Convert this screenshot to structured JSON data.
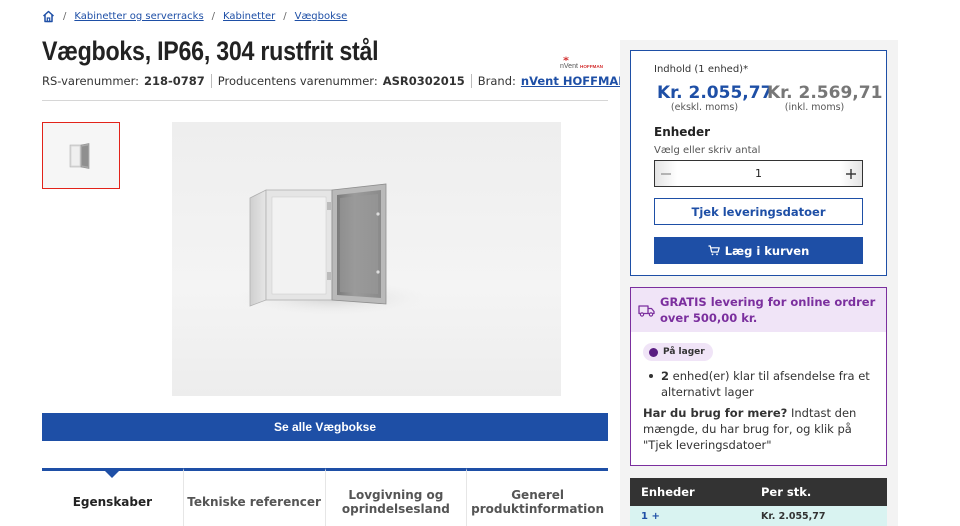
{
  "breadcrumb": {
    "items": [
      {
        "label": "Kabinetter og serverracks"
      },
      {
        "label": "Kabinetter"
      },
      {
        "label": "Vægbokse"
      }
    ],
    "separator": "/"
  },
  "product": {
    "title": "Vægboks, IP66, 304 rustfrit stål",
    "rs_label": "RS-varenummer:",
    "rs_value": "218-0787",
    "mfr_label": "Producentens varenummer:",
    "mfr_value": "ASR0302015",
    "brand_label": "Brand:",
    "brand_value": "nVent HOFFMAN"
  },
  "brand_logo": {
    "text_main": "nVent",
    "text_sub": "HOFFMAN"
  },
  "see_all_label": "Se alle Vægbokse",
  "tabs": [
    {
      "label": "Egenskaber",
      "active": true
    },
    {
      "label": "Tekniske referencer",
      "active": false
    },
    {
      "label": "Lovgivning og oprindelsesland",
      "active": false
    },
    {
      "label": "Generel produktinformation",
      "active": false
    }
  ],
  "pricing": {
    "content_label": "Indhold (1 enhed)*",
    "price_ex": "Kr. 2.055,77",
    "price_ex_note": "(ekskl. moms)",
    "price_inc": "Kr. 2.569,71",
    "price_inc_note": "(inkl. moms)",
    "units_label": "Enheder",
    "units_help": "Vælg eller skriv antal",
    "quantity": "1",
    "check_delivery_label": "Tjek leveringsdatoer",
    "add_to_cart_label": "Læg i kurven"
  },
  "shipping": {
    "free_text": "GRATIS levering for online ordrer over 500,00 kr.",
    "stock_badge": "På lager",
    "stock_count": "2",
    "stock_text": "enhed(er) klar til afsendelse fra et alternativt lager",
    "more_question": "Har du brug for mere?",
    "more_text": "Indtast den mængde, du har brug for, og klik på \"Tjek leveringsdatoer\""
  },
  "price_table": {
    "headers": [
      "Enheder",
      "Per stk."
    ],
    "rows": [
      {
        "units": "1 +",
        "price": "Kr. 2.055,77"
      }
    ]
  },
  "colors": {
    "accent": "#1e4fa6",
    "thumb_border": "#e2231a",
    "shipping": "#7b2f9e"
  }
}
